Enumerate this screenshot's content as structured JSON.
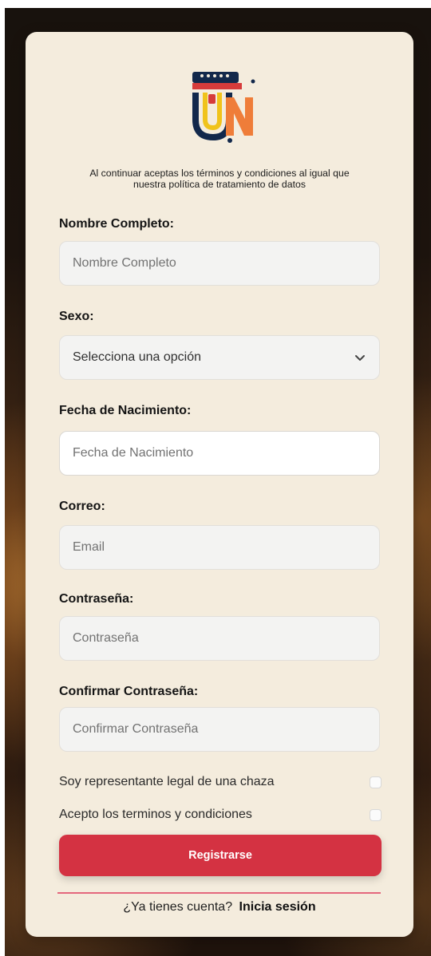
{
  "page": {
    "terms_notice_line1": "Al continuar aceptas los términos y condiciones al igual que",
    "terms_notice_line2": "nuestra política de tratamiento de datos"
  },
  "form": {
    "full_name": {
      "label": "Nombre Completo:",
      "placeholder": "Nombre Completo",
      "value": ""
    },
    "sex": {
      "label": "Sexo:",
      "selected": "Selecciona una opción"
    },
    "birth_date": {
      "label": "Fecha de Nacimiento:",
      "placeholder": "Fecha de Nacimiento",
      "value": ""
    },
    "email": {
      "label": "Correo:",
      "placeholder": "Email",
      "value": ""
    },
    "password": {
      "label": "Contraseña:",
      "placeholder": "Contraseña",
      "value": ""
    },
    "confirm_password": {
      "label": "Confirmar Contraseña:",
      "placeholder": "Confirmar Contraseña",
      "value": ""
    },
    "legal_representative": {
      "label": "Soy representante legal de una chaza",
      "checked": false
    },
    "accept_terms": {
      "label": "Acepto los terminos y condiciones",
      "checked": false
    },
    "submit_label": "Registrarse",
    "login_prompt": "¿Ya tienes cuenta?",
    "login_link": "Inicia sesión"
  },
  "icons": {
    "logo": "un-store-logo",
    "select_arrow": "chevron-down-icon"
  },
  "colors": {
    "card_background": "#f4ecdd",
    "primary_button": "#d43242",
    "divider": "#e4677c",
    "logo_navy": "#12284b",
    "logo_yellow": "#f0c31b",
    "logo_red": "#d63b3b",
    "logo_orange": "#ef7d39"
  }
}
